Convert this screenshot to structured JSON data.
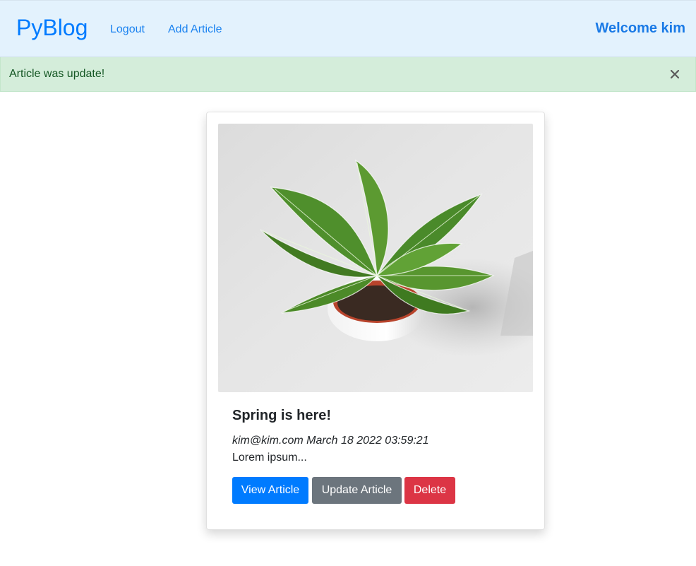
{
  "navbar": {
    "brand": "PyBlog",
    "links": [
      {
        "label": "Logout"
      },
      {
        "label": "Add Article"
      }
    ],
    "welcome": "Welcome kim",
    "background_color": "#e3f2fd",
    "link_color": "#007bff"
  },
  "alert": {
    "message": "Article was update!",
    "close_icon": "close-icon",
    "background_color": "#d4edda",
    "text_color": "#155724"
  },
  "article": {
    "image": "potted-striped-plant-photo",
    "title": "Spring is here!",
    "meta": "kim@kim.com March 18 2022 03:59:21",
    "excerpt": "Lorem ipsum...",
    "buttons": {
      "view": "View Article",
      "update": "Update Article",
      "delete": "Delete"
    },
    "button_colors": {
      "view": "#007bff",
      "update": "#6c757d",
      "delete": "#dc3545"
    }
  }
}
